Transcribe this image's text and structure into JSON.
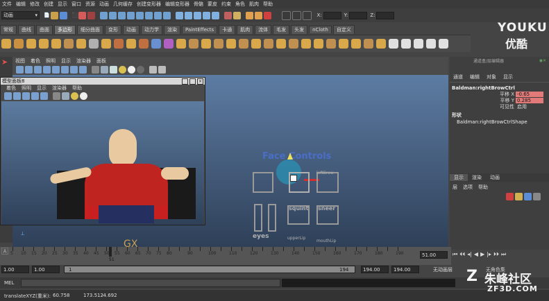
{
  "menu": [
    "文件",
    "编辑",
    "修改",
    "创建",
    "显示",
    "窗口",
    "资源",
    "动画",
    "几何缓存",
    "创建变形器",
    "编辑变形器",
    "骨骼",
    "蒙皮",
    "约束",
    "角色",
    "肌肉",
    "帮助"
  ],
  "status": {
    "mode_select": "动画",
    "x_label": "X:",
    "y_label": "Y:",
    "z_label": "Z:"
  },
  "shelf_tabs": [
    "常规",
    "曲线",
    "曲面",
    "多边形",
    "细分曲面",
    "变形",
    "动画",
    "动力学",
    "渲染",
    "PaintEffects",
    "卡通",
    "肌肉",
    "流体",
    "毛发",
    "头发",
    "nCloth",
    "自定义"
  ],
  "shelf_active": "多边形",
  "panel_menu": [
    "视图",
    "着色",
    "照明",
    "显示",
    "渲染器",
    "面板"
  ],
  "panel_window": {
    "title": "模型面板8",
    "menu": [
      "着色",
      "照明",
      "显示",
      "渲染器",
      "帮助"
    ]
  },
  "viewport": {
    "face_controls": "Face Controls",
    "labels": [
      "leftBrow",
      "squint",
      "sneer",
      "eyes",
      "upperLip",
      "mouthLip"
    ]
  },
  "channel_box": {
    "title": "通道盒/层编辑器",
    "menu": [
      "通道",
      "编辑",
      "对象",
      "显示"
    ],
    "node": "Baldman:rightBrowCtrl",
    "attrs": [
      {
        "name": "平移 X",
        "value": "-0.65"
      },
      {
        "name": "平移 Y",
        "value": "0.285"
      },
      {
        "name": "可见性",
        "value": "启用"
      }
    ],
    "shapes_label": "形状",
    "shape": "Baldman:rightBrowCtrlShape",
    "layer_tabs": [
      "显示",
      "渲染",
      "动画"
    ],
    "layer_menu": [
      "层",
      "选项",
      "帮助"
    ]
  },
  "timeline": {
    "ticks": [
      "5",
      "10",
      "15",
      "20",
      "25",
      "30",
      "35",
      "40",
      "45",
      "50",
      "55",
      "60",
      "65",
      "70",
      "75",
      "80",
      "90",
      "100",
      "110",
      "120",
      "130",
      "140",
      "150",
      "160",
      "170",
      "180",
      "190"
    ],
    "current_frame": "51",
    "frame_field": "51.00"
  },
  "range": {
    "start": "1.00",
    "start2": "1.00",
    "range_start": "1",
    "range_end": "194",
    "end": "194.00",
    "end2": "194.00",
    "anim_layer": "无动画层",
    "char_set": "无角色集"
  },
  "mel": {
    "label": "MEL"
  },
  "help_line": {
    "text": "translateXYZ(重米):",
    "vals": [
      "60.758",
      "173.512",
      "-4.692"
    ]
  },
  "watermarks": {
    "youku_brand": "YOUKU",
    "youku_sub": "优酷",
    "zf3d_brand": "朱峰社区",
    "zf3d_url": "ZF3D.COM"
  },
  "colors": {
    "accent": "#d9a24a",
    "attr_highlight": "#e27a7a"
  }
}
